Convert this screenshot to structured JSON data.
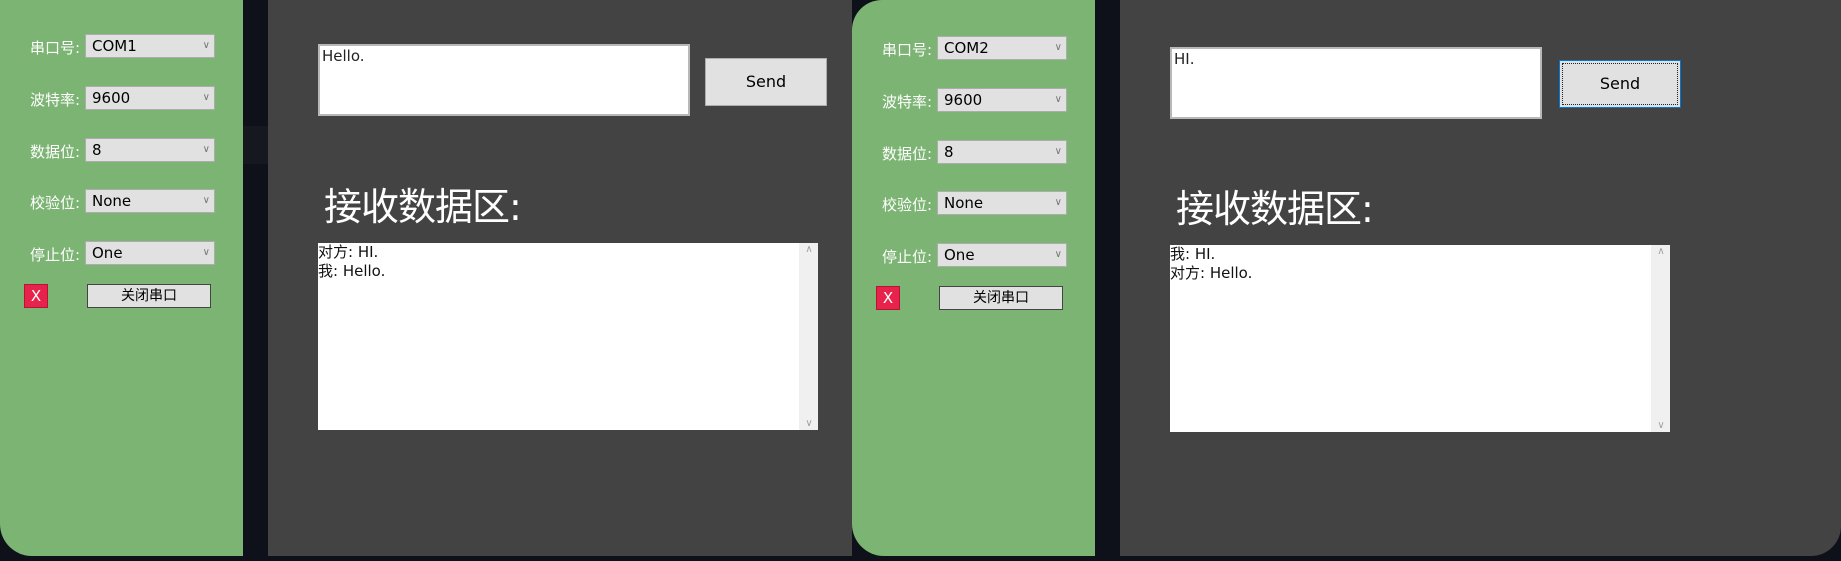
{
  "win1": {
    "settings": [
      {
        "label": "串口号:",
        "value": "COM1"
      },
      {
        "label": "波特率:",
        "value": "9600"
      },
      {
        "label": "数据位:",
        "value": "8"
      },
      {
        "label": "校验位:",
        "value": "None"
      },
      {
        "label": "停止位:",
        "value": "One"
      }
    ],
    "status_x": "X",
    "close_port_label": "关闭串口",
    "send_text": "Hello.",
    "send_label": "Send",
    "receive_title": "接收数据区:",
    "received_lines": [
      "对方: HI.",
      "我: Hello."
    ]
  },
  "win2": {
    "settings": [
      {
        "label": "串口号:",
        "value": "COM2"
      },
      {
        "label": "波特率:",
        "value": "9600"
      },
      {
        "label": "数据位:",
        "value": "8"
      },
      {
        "label": "校验位:",
        "value": "None"
      },
      {
        "label": "停止位:",
        "value": "One"
      }
    ],
    "status_x": "X",
    "close_port_label": "关闭串口",
    "send_text": "HI.",
    "send_label": "Send",
    "receive_title": "接收数据区:",
    "received_lines": [
      "我: HI.",
      "对方: Hello."
    ]
  },
  "icons": {
    "dropdown": "chevron-down-icon",
    "scroll_up": "scroll-up-icon",
    "scroll_down": "scroll-down-icon"
  },
  "colors": {
    "sidebar": "#7cb473",
    "main": "#434343",
    "status_red": "#e8234b"
  }
}
